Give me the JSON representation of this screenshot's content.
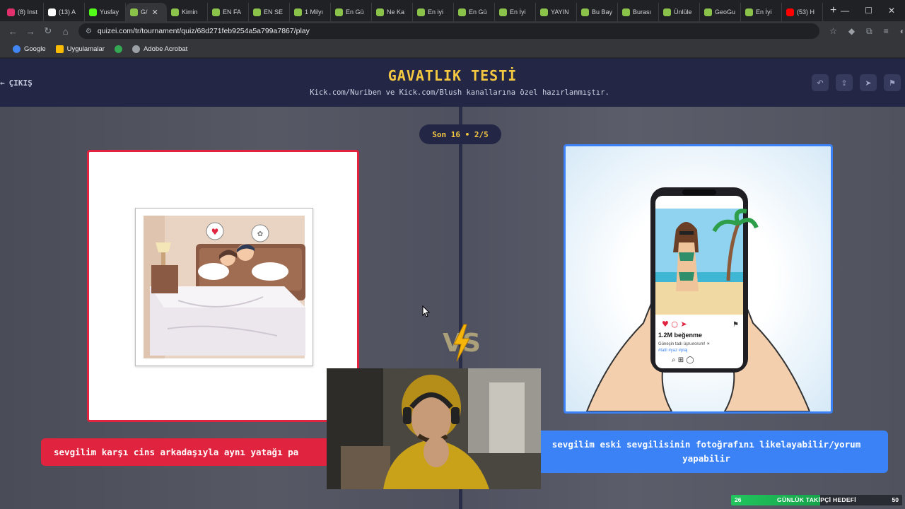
{
  "browser": {
    "tabs": [
      {
        "label": "(8) Inst",
        "color": "#e1306c"
      },
      {
        "label": "(13) A",
        "color": "#ffffff",
        "glyph": "X"
      },
      {
        "label": "Yusfay",
        "color": "#53fc18",
        "glyph": "K"
      },
      {
        "label": "G/",
        "color": "#8bc34a",
        "active": true
      },
      {
        "label": "Kimin",
        "color": "#8bc34a"
      },
      {
        "label": "EN FA",
        "color": "#8bc34a"
      },
      {
        "label": "EN SE",
        "color": "#8bc34a"
      },
      {
        "label": "1 Milyı",
        "color": "#8bc34a"
      },
      {
        "label": "En Gü",
        "color": "#8bc34a"
      },
      {
        "label": "Ne Ka",
        "color": "#8bc34a"
      },
      {
        "label": "En iyi",
        "color": "#8bc34a"
      },
      {
        "label": "En Gü",
        "color": "#8bc34a"
      },
      {
        "label": "En İyi",
        "color": "#8bc34a"
      },
      {
        "label": "YAYIN",
        "color": "#8bc34a"
      },
      {
        "label": "Bu Bay",
        "color": "#8bc34a"
      },
      {
        "label": "Burası",
        "color": "#8bc34a"
      },
      {
        "label": "Ünlüle",
        "color": "#8bc34a"
      },
      {
        "label": "GeoGu",
        "color": "#8bc34a"
      },
      {
        "label": "En İyi",
        "color": "#8bc34a"
      },
      {
        "label": "(53) H",
        "color": "#ff0000"
      }
    ],
    "url": "quizei.com/tr/tournament/quiz/68d271feb9254a5a799a7867/play",
    "bookmarks": [
      {
        "label": "Google",
        "color": "#4285f4"
      },
      {
        "label": "Uygulamalar",
        "color": "#fbbc05"
      },
      {
        "label": "",
        "color": "#34a853"
      },
      {
        "label": "Adobe Acrobat",
        "color": "#9aa0a6"
      }
    ]
  },
  "page": {
    "exit_label": "ÇIKIŞ",
    "title": "GAVATLIK TESTİ",
    "subtitle": "Kick.com/Nuriben ve Kick.com/Blush kanallarına özel hazırlanmıştır.",
    "round_label": "Son 16 • 2/5",
    "vs_label": "VS",
    "left_caption": "sevgilim karşı cins arkadaşıyla aynı yatağı pa",
    "right_caption": "sevgilim eski sevgilisinin fotoğrafını likelayabilir/yorum yapabilir",
    "phone": {
      "likes": "1.2M beğenme",
      "post_text": "Güneşin tadı üçruırorum! ☀",
      "tags": "#tatil #yaz #plaj"
    },
    "accent_yellow": "#f5c842",
    "left_color": "#e0233e",
    "right_color": "#3b82f6"
  },
  "overlay": {
    "goal_label": "GÜNLÜK TAKİPÇİ HEDEFİ",
    "goal_current": "26",
    "goal_target": "50",
    "goal_progress": 0.52
  }
}
